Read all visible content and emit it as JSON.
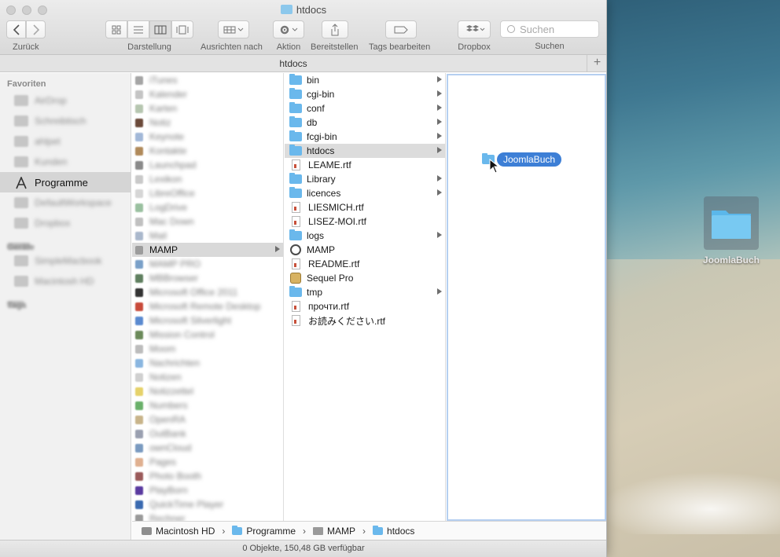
{
  "window": {
    "title": "htdocs"
  },
  "toolbar": {
    "back_label": "Zurück",
    "view_label": "Darstellung",
    "arrange_label": "Ausrichten nach",
    "action_label": "Aktion",
    "share_label": "Bereitstellen",
    "tags_label": "Tags bearbeiten",
    "dropbox_label": "Dropbox",
    "search_label": "Suchen",
    "search_placeholder": "Suchen"
  },
  "tabbar": {
    "title": "htdocs"
  },
  "sidebar": {
    "favorites_heading": "Favoriten",
    "devices_heading": "Geräte",
    "tags_heading": "Tags",
    "selected_item": "Programme",
    "favorites": [
      "AirDrop",
      "Schreibtisch",
      "ahlpet",
      "Kunden",
      "Programme",
      "DefaultWorkspace",
      "Dropbox"
    ],
    "devices": [
      "SimpleMacbook",
      "Macintosh HD"
    ]
  },
  "column_apps": {
    "selected": "MAMP",
    "items_before": [
      "iTunes",
      "Kalender",
      "Karten",
      "Notiz",
      "Keynote",
      "Kontakte",
      "Launchpad",
      "Lexikon",
      "LibreOffice",
      "LogDrive",
      "Mac Down",
      "Mail"
    ],
    "items_after": [
      "MAMP PRO",
      "MBBrowser",
      "Microsoft Office 2011",
      "Microsoft Remote Desktop",
      "Microsoft Silverlight",
      "Mission Control",
      "Moom",
      "Nachrichten",
      "Notizen",
      "Notizzettel",
      "Numbers",
      "OpenRA",
      "OutBank",
      "ownCloud",
      "Pages",
      "Photo Booth",
      "PlayBorn",
      "QuickTime Player",
      "Rechner"
    ]
  },
  "column_mamp": {
    "items": [
      {
        "name": "bin",
        "kind": "folder",
        "has_children": true
      },
      {
        "name": "cgi-bin",
        "kind": "folder",
        "has_children": true
      },
      {
        "name": "conf",
        "kind": "folder",
        "has_children": true
      },
      {
        "name": "db",
        "kind": "folder",
        "has_children": true
      },
      {
        "name": "fcgi-bin",
        "kind": "folder",
        "has_children": true
      },
      {
        "name": "htdocs",
        "kind": "folder",
        "has_children": true,
        "selected": true
      },
      {
        "name": "LEAME.rtf",
        "kind": "document",
        "has_children": false
      },
      {
        "name": "Library",
        "kind": "folder",
        "has_children": true
      },
      {
        "name": "licences",
        "kind": "folder",
        "has_children": true
      },
      {
        "name": "LIESMICH.rtf",
        "kind": "document",
        "has_children": false
      },
      {
        "name": "LISEZ-MOI.rtf",
        "kind": "document",
        "has_children": false
      },
      {
        "name": "logs",
        "kind": "folder",
        "has_children": true
      },
      {
        "name": "MAMP",
        "kind": "app",
        "has_children": false
      },
      {
        "name": "README.rtf",
        "kind": "document",
        "has_children": false
      },
      {
        "name": "Sequel Pro",
        "kind": "database-app",
        "has_children": false
      },
      {
        "name": "tmp",
        "kind": "folder",
        "has_children": true
      },
      {
        "name": "прочти.rtf",
        "kind": "document",
        "has_children": false
      },
      {
        "name": "お読みください.rtf",
        "kind": "document",
        "has_children": false
      }
    ]
  },
  "column_htdocs": {
    "dragged_item": "JoomlaBuch"
  },
  "pathbar": {
    "crumbs": [
      "Macintosh HD",
      "Programme",
      "MAMP",
      "htdocs"
    ]
  },
  "statusbar": {
    "text": "0 Objekte, 150,48 GB verfügbar"
  },
  "desktop": {
    "icon_label": "JoomlaBuch"
  },
  "colors": {
    "folder": "#6ab8ec",
    "selection": "#3d7fd6",
    "drop_highlight": "#b5cff0"
  }
}
